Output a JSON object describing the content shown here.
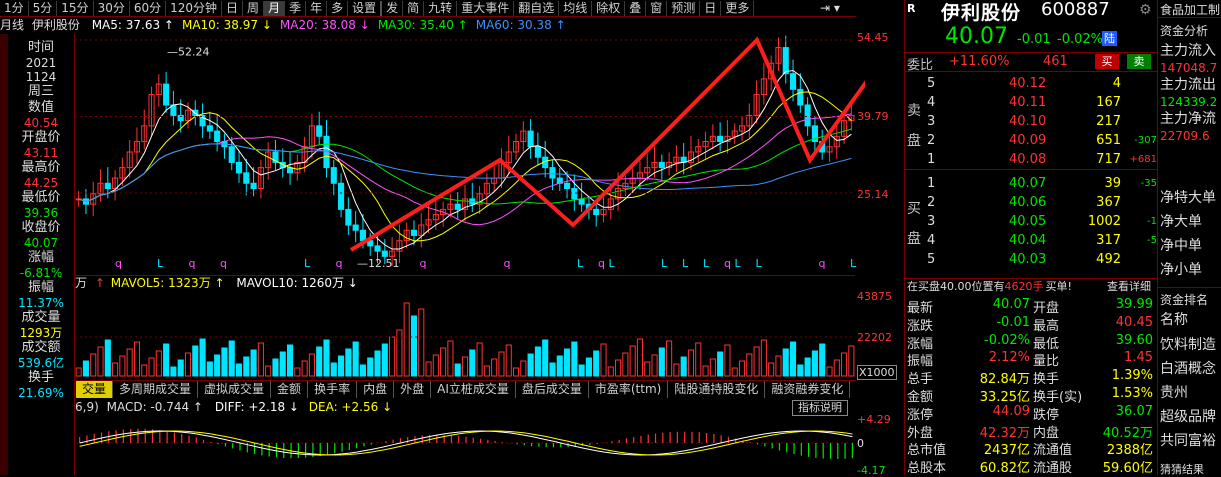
{
  "toolbar": {
    "items": [
      "1分",
      "5分",
      "15分",
      "30分",
      "60分",
      "120分钟",
      "日",
      "周",
      "月",
      "季",
      "年",
      "多",
      "设置",
      "发",
      "简",
      "九转",
      "重大事件",
      "翻自选",
      "均线",
      "除权",
      "叠",
      "窗",
      "预测",
      "日",
      "更多"
    ],
    "active": "月"
  },
  "stock_header": {
    "period": "月线",
    "name": "伊利股份",
    "ma": [
      {
        "label": "MA5: 37.63 ↑",
        "color": "#ffffff"
      },
      {
        "label": "MA10: 38.97 ↓",
        "color": "#ffff00"
      },
      {
        "label": "MA20: 38.08 ↓",
        "color": "#ff50ff"
      },
      {
        "label": "MA30: 35.40 ↑",
        "color": "#00e600"
      },
      {
        "label": "MA60: 30.38 ↑",
        "color": "#3f8fff"
      }
    ]
  },
  "price_axis": [
    "54.45",
    "39.79",
    "25.14"
  ],
  "price_markers": {
    "high": "52.24",
    "low": "12.51"
  },
  "left_info": [
    {
      "label": "时间",
      "value": "2021"
    },
    {
      "label": "",
      "value": "1124"
    },
    {
      "label": "周三",
      "value": ""
    },
    {
      "label": "数值",
      "value": "40.54"
    },
    {
      "label": "开盘价",
      "value": "43.11"
    },
    {
      "label": "最高价",
      "value": "44.25"
    },
    {
      "label": "最低价",
      "value": "39.36"
    },
    {
      "label": "收盘价",
      "value": "40.07"
    },
    {
      "label": "涨幅",
      "value": "-6.81%"
    },
    {
      "label": "振幅",
      "value": "11.37%"
    },
    {
      "label": "成交量",
      "value": "1293万"
    },
    {
      "label": "成交额",
      "value": "539.6亿"
    },
    {
      "label": "换手",
      "value": "21.69%"
    }
  ],
  "volume_header": {
    "unit": "万",
    "vol5": "MAVOL5: 1323万 ↑",
    "vol10": "MAVOL10: 1260万 ↓"
  },
  "volume_axis": [
    "43875",
    "22202",
    "X1000"
  ],
  "indicator_tabs": [
    "交量",
    "多周期成交量",
    "虚拟成交量",
    "金额",
    "换手率",
    "内盘",
    "外盘",
    "AI立桩成交量",
    "盘后成交量",
    "市盈率(ttm)",
    "陆股通持股变化",
    "融资融券变化"
  ],
  "macd_header": {
    "params": "6,9)",
    "macd": "MACD: -0.744 ↑",
    "diff": "DIFF: +2.18 ↓",
    "dea": "DEA: +2.56 ↓",
    "help": "指标说明"
  },
  "macd_axis": [
    "+4.29",
    "0",
    "-4.17"
  ],
  "quote": {
    "logo": "R",
    "name": "伊利股份",
    "code": "600887",
    "price": "40.07",
    "change": "-0.01",
    "pct": "-0.02%",
    "exchange": "陆",
    "webi_label": "委比",
    "webi": "+11.60%",
    "webi_diff": "461",
    "buy_btn": "买",
    "sell_btn": "卖"
  },
  "asks": [
    {
      "lvl": "5",
      "price": "40.12",
      "vol": "4",
      "chg": ""
    },
    {
      "lvl": "4",
      "price": "40.11",
      "vol": "167",
      "chg": ""
    },
    {
      "lvl": "3",
      "price": "40.10",
      "vol": "217",
      "chg": ""
    },
    {
      "lvl": "2",
      "price": "40.09",
      "vol": "651",
      "chg": "-307"
    },
    {
      "lvl": "1",
      "price": "40.08",
      "vol": "717",
      "chg": "+681"
    }
  ],
  "ask_label": [
    "卖",
    "盘"
  ],
  "bids": [
    {
      "lvl": "1",
      "price": "40.07",
      "vol": "39",
      "chg": "-35"
    },
    {
      "lvl": "2",
      "price": "40.06",
      "vol": "367",
      "chg": ""
    },
    {
      "lvl": "3",
      "price": "40.05",
      "vol": "1002",
      "chg": "-1"
    },
    {
      "lvl": "4",
      "price": "40.04",
      "vol": "317",
      "chg": "-5"
    },
    {
      "lvl": "5",
      "price": "40.03",
      "vol": "492",
      "chg": ""
    }
  ],
  "bid_label": [
    "买",
    "盘"
  ],
  "notice": {
    "text": "在买盘40.00位置有",
    "qty": "4620手",
    "suffix": "买单!",
    "link": "查看详细"
  },
  "stats": [
    {
      "l": "最新",
      "v": "40.07",
      "vc": "green",
      "l2": "开盘",
      "v2": "39.99",
      "v2c": "green"
    },
    {
      "l": "涨跌",
      "v": "-0.01",
      "vc": "green",
      "l2": "最高",
      "v2": "40.45",
      "v2c": "red"
    },
    {
      "l": "涨幅",
      "v": "-0.02%",
      "vc": "green",
      "l2": "最低",
      "v2": "39.60",
      "v2c": "green"
    },
    {
      "l": "振幅",
      "v": "2.12%",
      "vc": "red",
      "l2": "量比",
      "v2": "1.45",
      "v2c": "red"
    },
    {
      "l": "总手",
      "v": "82.84万",
      "vc": "yellow",
      "l2": "换手",
      "v2": "1.39%",
      "v2c": "yellow"
    },
    {
      "l": "金额",
      "v": "33.25亿",
      "vc": "yellow",
      "l2": "换手(实)",
      "v2": "1.53%",
      "v2c": "yellow"
    },
    {
      "l": "涨停",
      "v": "44.09",
      "vc": "red",
      "l2": "跌停",
      "v2": "36.07",
      "v2c": "green"
    },
    {
      "l": "外盘",
      "v": "42.32万",
      "vc": "red",
      "l2": "内盘",
      "v2": "40.52万",
      "v2c": "green"
    },
    {
      "l": "总市值",
      "v": "2437亿",
      "vc": "yellow",
      "l2": "流通值",
      "v2": "2388亿",
      "v2c": "yellow"
    },
    {
      "l": "总股本",
      "v": "60.82亿",
      "vc": "yellow",
      "l2": "流通股",
      "v2": "59.60亿",
      "v2c": "yellow"
    }
  ],
  "far_right": {
    "top": "食品加工制",
    "fund_title": "资金分析",
    "fund_items": [
      {
        "label": "主力流入",
        "value": "147048.7"
      },
      {
        "label": "主力流出",
        "value": "124339.2"
      },
      {
        "label": "主力净流",
        "value": "22709.6"
      }
    ],
    "net_items": [
      "净特大单",
      "净大单",
      "净中单",
      "净小单"
    ],
    "rank_title": "资金排名",
    "rank_name": "名称",
    "rank_items": [
      "饮料制造",
      "白酒概念",
      "贵州",
      "超级品牌",
      "共同富裕"
    ],
    "bottom": "猜猜结果"
  }
}
